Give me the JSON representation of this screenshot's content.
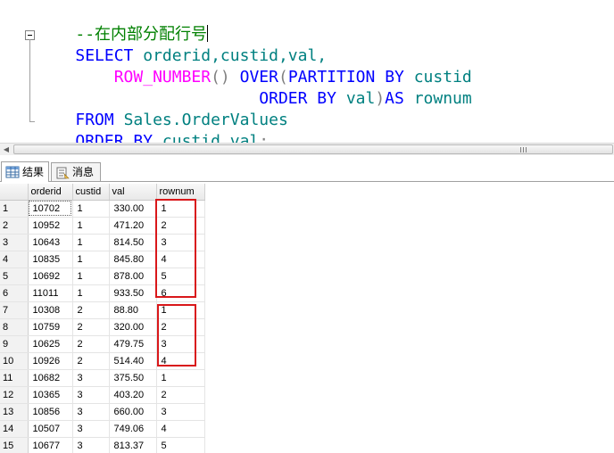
{
  "editor": {
    "comment": "--在内部分配行号",
    "line2": {
      "kw_select": "SELECT",
      "cols": "orderid,custid,val,"
    },
    "line3": {
      "fn": "ROW_NUMBER",
      "parens": "()",
      "kw_over": "OVER",
      "open": "(",
      "kw_partition": "PARTITION BY",
      "col": "custid"
    },
    "line4": {
      "kw_order": "ORDER BY",
      "col": "val",
      "close": ")",
      "kw_as": "AS",
      "alias": "rownum"
    },
    "line5": {
      "kw_from": "FROM",
      "table": "Sales.OrderValues"
    },
    "line6": {
      "kw_order": "ORDER BY",
      "cols": "custid,val",
      "semi": ";"
    }
  },
  "tabs": {
    "results": "结果",
    "messages": "消息"
  },
  "grid": {
    "columns": [
      "orderid",
      "custid",
      "val",
      "rownum"
    ],
    "rows": [
      [
        "1",
        "10702",
        "1",
        "330.00",
        "1"
      ],
      [
        "2",
        "10952",
        "1",
        "471.20",
        "2"
      ],
      [
        "3",
        "10643",
        "1",
        "814.50",
        "3"
      ],
      [
        "4",
        "10835",
        "1",
        "845.80",
        "4"
      ],
      [
        "5",
        "10692",
        "1",
        "878.00",
        "5"
      ],
      [
        "6",
        "11011",
        "1",
        "933.50",
        "6"
      ],
      [
        "7",
        "10308",
        "2",
        "88.80",
        "1"
      ],
      [
        "8",
        "10759",
        "2",
        "320.00",
        "2"
      ],
      [
        "9",
        "10625",
        "2",
        "479.75",
        "3"
      ],
      [
        "10",
        "10926",
        "2",
        "514.40",
        "4"
      ],
      [
        "11",
        "10682",
        "3",
        "375.50",
        "1"
      ],
      [
        "12",
        "10365",
        "3",
        "403.20",
        "2"
      ],
      [
        "13",
        "10856",
        "3",
        "660.00",
        "3"
      ],
      [
        "14",
        "10507",
        "3",
        "749.06",
        "4"
      ],
      [
        "15",
        "10677",
        "3",
        "813.37",
        "5"
      ]
    ]
  },
  "colors": {
    "keyword": "#0000ff",
    "identifier": "#008080",
    "function": "#ff00ff",
    "comment": "#008000",
    "annotation": "#d9171a"
  }
}
